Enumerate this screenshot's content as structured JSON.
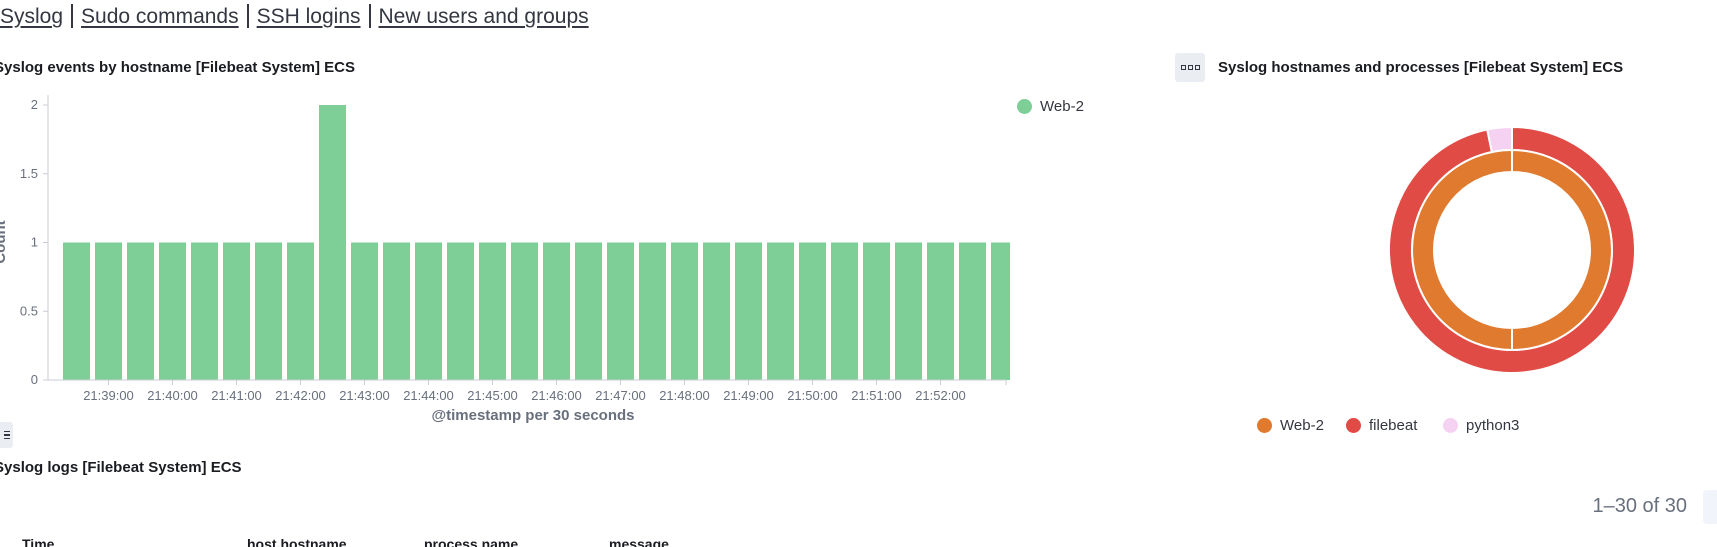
{
  "nav": {
    "links": [
      "Syslog",
      "Sudo commands",
      "SSH logins",
      "New users and groups"
    ]
  },
  "bar_panel": {
    "title": "Syslog events by hostname [Filebeat System] ECS",
    "legend": [
      {
        "label": "Web-2",
        "color": "#7dcf97"
      }
    ]
  },
  "donut_panel": {
    "title": "Syslog hostnames and processes [Filebeat System] ECS",
    "legend": [
      {
        "label": "Web-2",
        "color": "#e07a2f"
      },
      {
        "label": "filebeat",
        "color": "#e04b45"
      },
      {
        "label": "python3",
        "color": "#f6d2f2"
      }
    ]
  },
  "logs_panel": {
    "title": "Syslog logs [Filebeat System] ECS",
    "pagination": "1–30 of 30",
    "columns": [
      "Time",
      "host.hostname",
      "process.name",
      "message"
    ]
  },
  "chart_data": [
    {
      "type": "bar",
      "title": "Syslog events by hostname [Filebeat System] ECS",
      "xlabel": "@timestamp per 30 seconds",
      "ylabel": "Count",
      "ylim": [
        0,
        2
      ],
      "yticks": [
        "0",
        "0.5",
        "1",
        "1.5",
        "2"
      ],
      "xticks": [
        "21:39:00",
        "21:40:00",
        "21:41:00",
        "21:42:00",
        "21:43:00",
        "21:44:00",
        "21:45:00",
        "21:46:00",
        "21:47:00",
        "21:48:00",
        "21:49:00",
        "21:50:00",
        "21:51:00",
        "21:52:00"
      ],
      "legend_position": "top-right",
      "series": [
        {
          "name": "Web-2",
          "color": "#7dcf97",
          "values": [
            1,
            1,
            1,
            1,
            1,
            1,
            1,
            1,
            2,
            1,
            1,
            1,
            1,
            1,
            1,
            1,
            1,
            1,
            1,
            1,
            1,
            1,
            1,
            1,
            1,
            1,
            1,
            1,
            1,
            1
          ]
        }
      ]
    },
    {
      "type": "pie",
      "title": "Syslog hostnames and processes [Filebeat System] ECS",
      "legend_position": "bottom",
      "inner_ring": [
        {
          "label": "Web-2",
          "value": 31,
          "color": "#e07a2f"
        }
      ],
      "outer_ring": [
        {
          "label": "filebeat",
          "value": 30,
          "color": "#e04b45"
        },
        {
          "label": "python3",
          "value": 1,
          "color": "#f6d2f2"
        }
      ]
    }
  ]
}
